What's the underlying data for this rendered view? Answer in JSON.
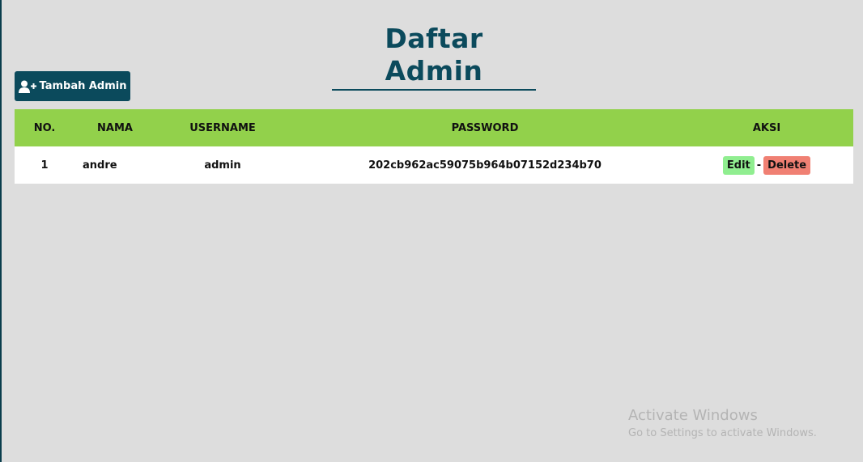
{
  "page": {
    "title": "Daftar Admin"
  },
  "toolbar": {
    "add_label": "Tambah Admin",
    "add_icon": "user-plus-icon"
  },
  "table": {
    "headers": [
      "NO.",
      "NAMA",
      "USERNAME",
      "PASSWORD",
      "AKSI"
    ],
    "rows": [
      {
        "no": "1",
        "nama": "andre",
        "username": "admin",
        "password": "202cb962ac59075b964b07152d234b70",
        "edit_label": "Edit",
        "separator": "-",
        "delete_label": "Delete"
      }
    ]
  },
  "watermark": {
    "title": "Activate Windows",
    "subtitle": "Go to Settings to activate Windows."
  },
  "colors": {
    "brand": "#0b4a5c",
    "header_green": "#92d14b",
    "edit_green": "#90ee90",
    "delete_red": "#f08073",
    "background": "#dddddd"
  }
}
